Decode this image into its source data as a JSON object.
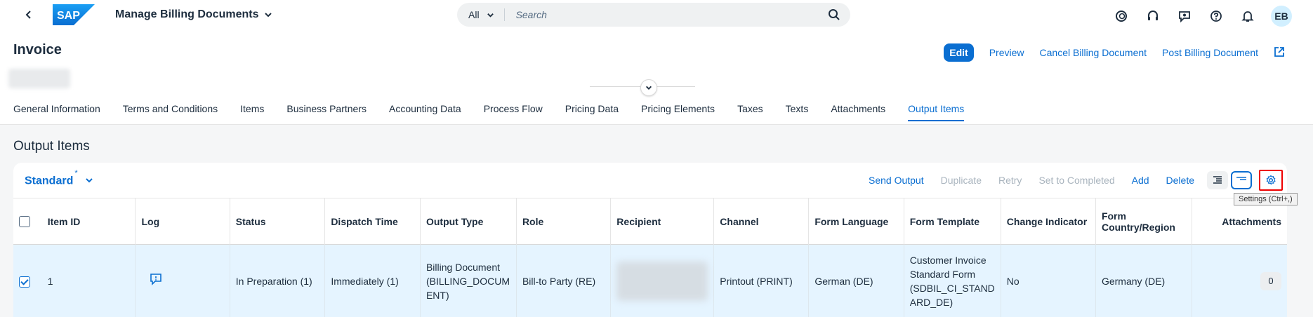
{
  "shell": {
    "logo_text": "SAP",
    "app_title": "Manage Billing Documents",
    "search_scope": "All",
    "search_placeholder": "Search",
    "user_initials": "EB"
  },
  "header": {
    "title": "Invoice",
    "actions": {
      "edit": "Edit",
      "preview": "Preview",
      "cancel": "Cancel Billing Document",
      "post": "Post Billing Document"
    }
  },
  "tabs": [
    {
      "label": "General Information"
    },
    {
      "label": "Terms and Conditions"
    },
    {
      "label": "Items"
    },
    {
      "label": "Business Partners"
    },
    {
      "label": "Accounting Data"
    },
    {
      "label": "Process Flow"
    },
    {
      "label": "Pricing Data"
    },
    {
      "label": "Pricing Elements"
    },
    {
      "label": "Taxes"
    },
    {
      "label": "Texts"
    },
    {
      "label": "Attachments"
    },
    {
      "label": "Output Items",
      "active": true
    }
  ],
  "section": {
    "title": "Output Items",
    "variant": "Standard",
    "variant_marker": "*"
  },
  "toolbar": {
    "send_output": "Send Output",
    "duplicate": "Duplicate",
    "retry": "Retry",
    "set_completed": "Set to Completed",
    "add": "Add",
    "delete": "Delete",
    "settings_tooltip": "Settings (Ctrl+,)"
  },
  "table": {
    "columns": {
      "item_id": "Item ID",
      "log": "Log",
      "status": "Status",
      "dispatch_time": "Dispatch Time",
      "output_type": "Output Type",
      "role": "Role",
      "recipient": "Recipient",
      "channel": "Channel",
      "form_language": "Form Language",
      "form_template": "Form Template",
      "change_indicator": "Change Indicator",
      "form_country": "Form Country/Region",
      "attachments": "Attachments"
    },
    "rows": [
      {
        "item_id": "1",
        "status": "In Preparation (1)",
        "dispatch_time": "Immediately (1)",
        "output_type_line1": "Billing Document",
        "output_type_line2": "(BILLING_DOCUM",
        "output_type_line3": "ENT)",
        "role": "Bill-to Party (RE)",
        "channel": "Printout (PRINT)",
        "form_language": "German (DE)",
        "form_template_line1": "Customer Invoice",
        "form_template_line2": "Standard Form",
        "form_template_line3": "(SDBIL_CI_STAND",
        "form_template_line4": "ARD_DE)",
        "change_indicator": "No",
        "form_country": "Germany (DE)",
        "attachments": "0"
      }
    ]
  }
}
